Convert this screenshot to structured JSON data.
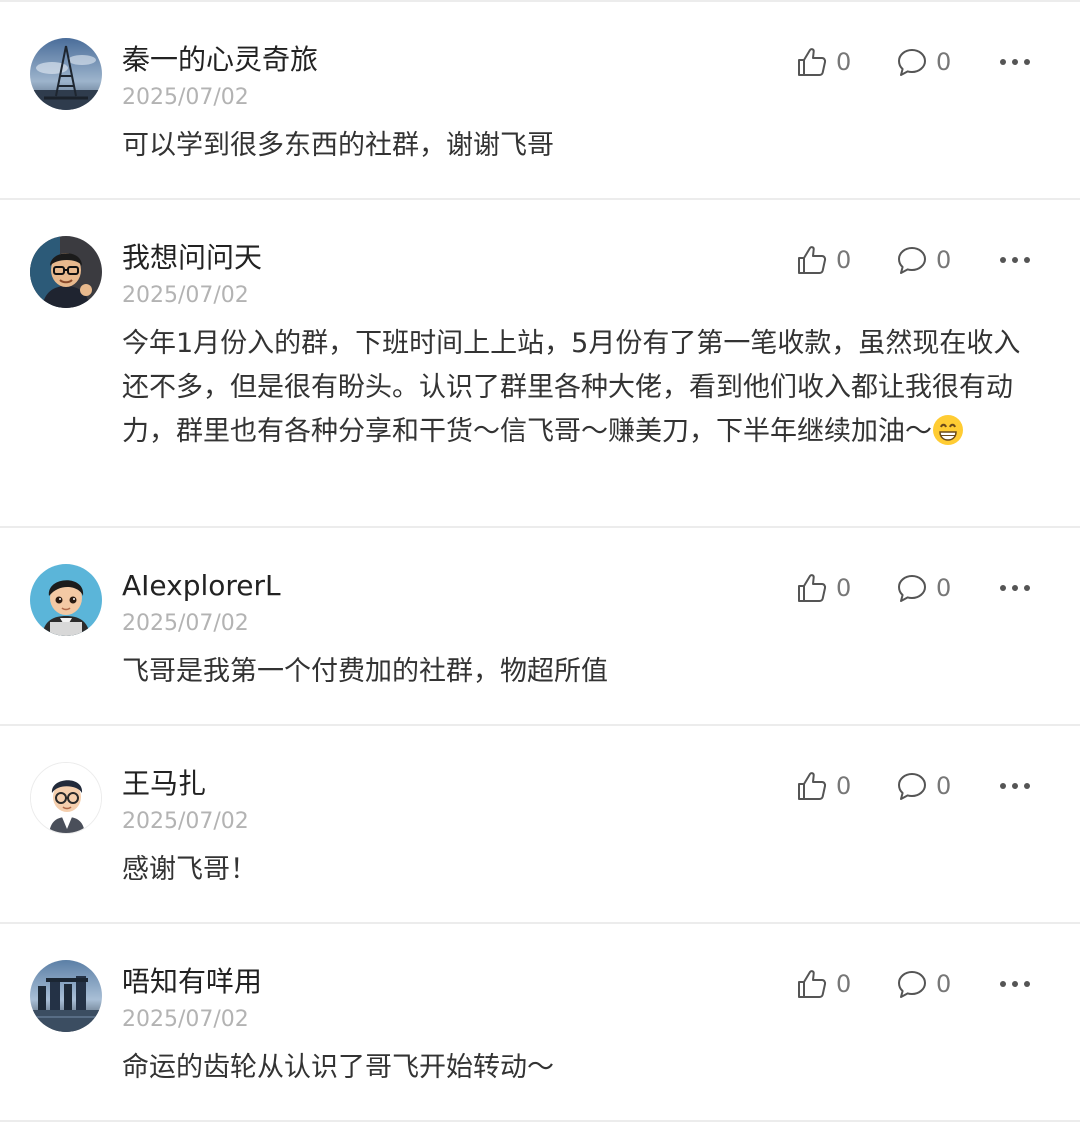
{
  "comments": [
    {
      "name": "秦一的心灵奇旅",
      "date": "2025/07/02",
      "text": "可以学到很多东西的社群，谢谢飞哥",
      "likes": "0",
      "replies": "0",
      "avatar": "tower-photo-avatar"
    },
    {
      "name": "我想问问天",
      "date": "2025/07/02",
      "text": "今年1月份入的群，下班时间上上站，5月份有了第一笔收款，虽然现在收入还不多，但是很有盼头。认识了群里各种大佬，看到他们收入都让我很有动力，群里也有各种分享和干货～信飞哥～赚美刀，下半年继续加油～",
      "emoji": "grinning-face-emoji",
      "likes": "0",
      "replies": "0",
      "avatar": "cartoon-glasses-man-avatar"
    },
    {
      "name": "AIexplorerL",
      "date": "2025/07/02",
      "text": "飞哥是我第一个付费加的社群，物超所值",
      "likes": "0",
      "replies": "0",
      "avatar": "cartoon-boy-avatar"
    },
    {
      "name": "王马扎",
      "date": "2025/07/02",
      "text": "感谢飞哥！",
      "likes": "0",
      "replies": "0",
      "avatar": "cartoon-glasses-boy-avatar"
    },
    {
      "name": "唔知有咩用",
      "date": "2025/07/02",
      "text": "命运的齿轮从认识了哥飞开始转动～",
      "likes": "0",
      "replies": "0",
      "avatar": "city-skyline-avatar"
    }
  ],
  "icons": {
    "like": "thumbs-up-icon",
    "reply": "comment-bubble-icon",
    "more": "more-dots-icon"
  },
  "colors": {
    "name": "#222222",
    "date": "#b3b3b3",
    "text": "#333333",
    "icon": "#555555",
    "divider": "#ececec"
  }
}
